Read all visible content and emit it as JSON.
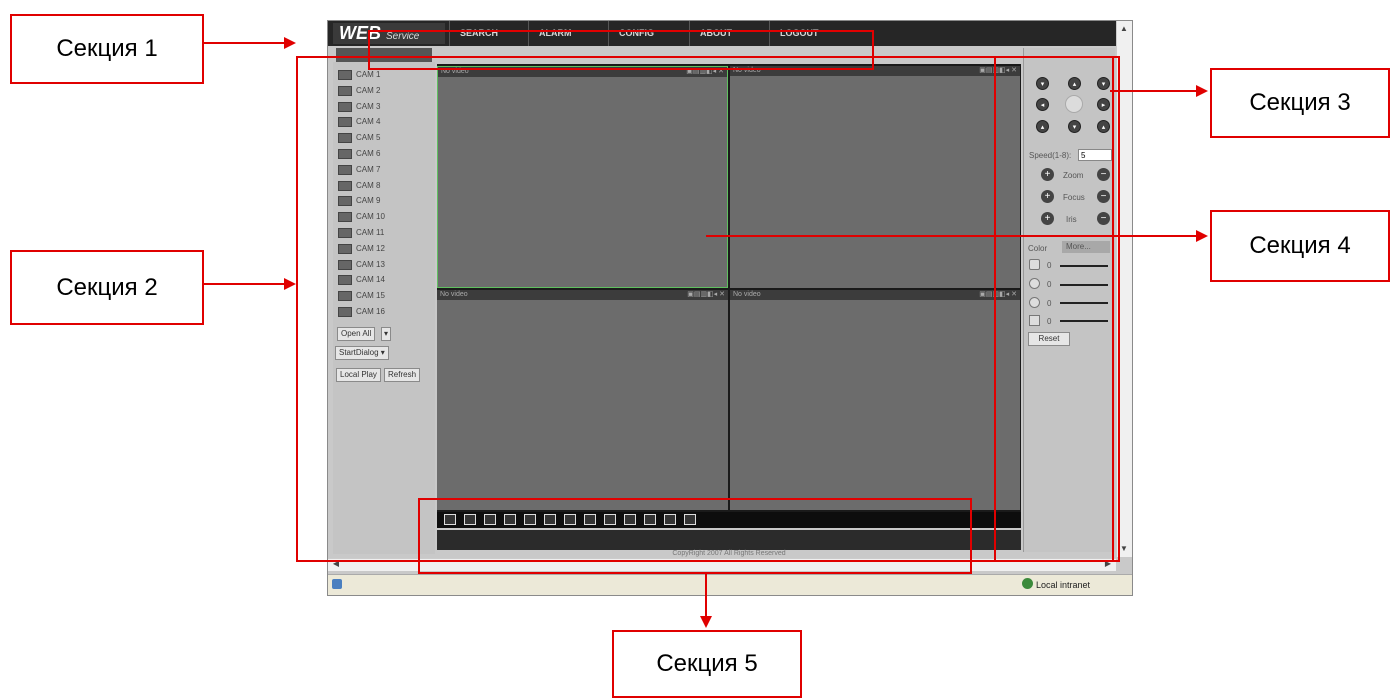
{
  "annotations": {
    "section1": "Секция 1",
    "section2": "Секция 2",
    "section3": "Секция 3",
    "section4": "Секция 4",
    "section5": "Секция 5"
  },
  "app": {
    "logo_main": "WEB",
    "logo_sub": "Service",
    "nav": [
      "SEARCH",
      "ALARM",
      "CONFIG",
      "ABOUT",
      "LOGOUT"
    ]
  },
  "cameras": [
    "CAM 1",
    "CAM 2",
    "CAM 3",
    "CAM 4",
    "CAM 5",
    "CAM 6",
    "CAM 7",
    "CAM 8",
    "CAM 9",
    "CAM 10",
    "CAM 11",
    "CAM 12",
    "CAM 13",
    "CAM 14",
    "CAM 15",
    "CAM 16"
  ],
  "left_buttons": {
    "open_all": "Open All",
    "start_dialog": "StartDialog",
    "local_play": "Local Play",
    "refresh": "Refresh"
  },
  "video": {
    "pane_label": "No video"
  },
  "ptz": {
    "speed_label": "Speed(1-8):",
    "speed_value": "5",
    "zoom": "Zoom",
    "focus": "Focus",
    "iris": "Iris"
  },
  "color": {
    "tab_color": "Color",
    "tab_more": "More...",
    "reset": "Reset",
    "slider_values": [
      "0",
      "0",
      "0",
      "0"
    ]
  },
  "footer": {
    "copyright": "CopyRight 2007 All Rights Reserved"
  },
  "ie_status": {
    "zone": "Local intranet"
  }
}
